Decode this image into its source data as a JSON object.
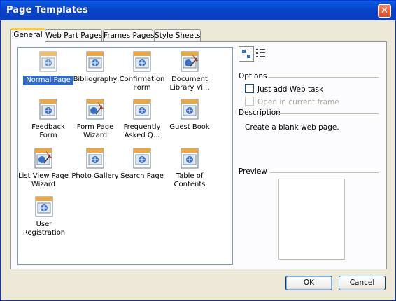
{
  "window": {
    "title": "Page Templates",
    "close_label": "✕"
  },
  "tabs": [
    {
      "label": "General",
      "active": true
    },
    {
      "label": "Web Part Pages"
    },
    {
      "label": "Frames Pages"
    },
    {
      "label": "Style Sheets"
    }
  ],
  "templates": [
    {
      "label": "Normal Page",
      "selected": true,
      "icon": "page-icon"
    },
    {
      "label": "Bibliography",
      "icon": "page-icon"
    },
    {
      "label": "Confirmation Form",
      "icon": "page-icon"
    },
    {
      "label": "Document Library Vi...",
      "icon": "webpart-page-icon"
    },
    {
      "label": "Feedback Form",
      "icon": "page-icon"
    },
    {
      "label": "Form Page Wizard",
      "icon": "webpart-page-icon"
    },
    {
      "label": "Frequently Asked Q...",
      "icon": "page-icon"
    },
    {
      "label": "Guest Book",
      "icon": "page-icon"
    },
    {
      "label": "List View Page Wizard",
      "icon": "webpart-page-icon"
    },
    {
      "label": "Photo Gallery",
      "icon": "page-icon"
    },
    {
      "label": "Search Page",
      "icon": "page-icon"
    },
    {
      "label": "Table of Contents",
      "icon": "page-icon"
    },
    {
      "label": "User Registration",
      "icon": "page-icon"
    }
  ],
  "view_buttons": {
    "large_icons": "large-icons-view-icon",
    "details": "details-view-icon"
  },
  "options": {
    "heading": "Options",
    "just_add_web_task": "Just add Web task",
    "open_in_current_frame": "Open in current frame"
  },
  "description": {
    "heading": "Description",
    "text": "Create a blank web page."
  },
  "preview": {
    "heading": "Preview"
  },
  "buttons": {
    "ok": "OK",
    "cancel": "Cancel"
  },
  "colors": {
    "title_bar": "#0842c8",
    "selection": "#316ac5",
    "tab_highlight": "#ffc83c",
    "close_button": "#d54d28"
  }
}
